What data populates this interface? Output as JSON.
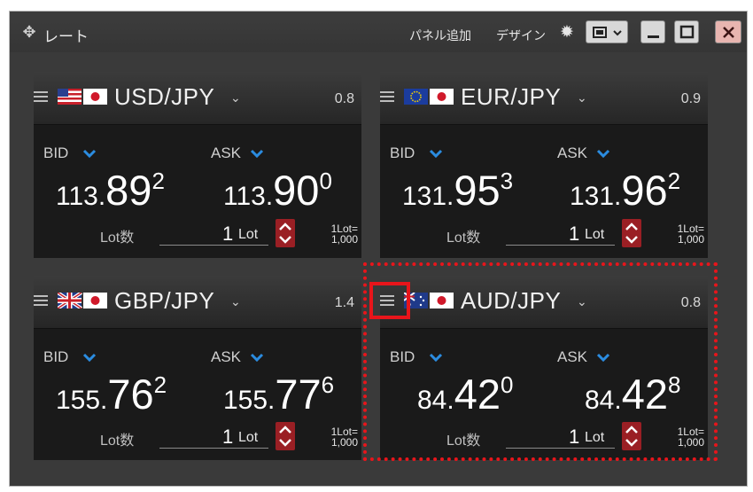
{
  "window": {
    "title": "レート",
    "add_panel_label": "パネル追加",
    "design_label": "デザイン"
  },
  "colors": {
    "accent_blue": "#2b8ce0",
    "stepper_red": "#9a1f24",
    "highlight_red": "#e8151b"
  },
  "panels": [
    {
      "pair": "USD/JPY",
      "spread": "0.8",
      "bid_label": "BID",
      "ask_label": "ASK",
      "bid_small": "113.",
      "bid_large": "89",
      "bid_sup": "2",
      "ask_small": "113.",
      "ask_large": "90",
      "ask_sup": "0",
      "lot_label": "Lot数",
      "lot_value": "1",
      "lot_unit": "Lot",
      "lot_info_1": "1Lot=",
      "lot_info_2": "1,000"
    },
    {
      "pair": "EUR/JPY",
      "spread": "0.9",
      "bid_label": "BID",
      "ask_label": "ASK",
      "bid_small": "131.",
      "bid_large": "95",
      "bid_sup": "3",
      "ask_small": "131.",
      "ask_large": "96",
      "ask_sup": "2",
      "lot_label": "Lot数",
      "lot_value": "1",
      "lot_unit": "Lot",
      "lot_info_1": "1Lot=",
      "lot_info_2": "1,000"
    },
    {
      "pair": "GBP/JPY",
      "spread": "1.4",
      "bid_label": "BID",
      "ask_label": "ASK",
      "bid_small": "155.",
      "bid_large": "76",
      "bid_sup": "2",
      "ask_small": "155.",
      "ask_large": "77",
      "ask_sup": "6",
      "lot_label": "Lot数",
      "lot_value": "1",
      "lot_unit": "Lot",
      "lot_info_1": "1Lot=",
      "lot_info_2": "1,000"
    },
    {
      "pair": "AUD/JPY",
      "spread": "0.8",
      "bid_label": "BID",
      "ask_label": "ASK",
      "bid_small": "84.",
      "bid_large": "42",
      "bid_sup": "0",
      "ask_small": "84.",
      "ask_large": "42",
      "ask_sup": "8",
      "lot_label": "Lot数",
      "lot_value": "1",
      "lot_unit": "Lot",
      "lot_info_1": "1Lot=",
      "lot_info_2": "1,000"
    }
  ]
}
